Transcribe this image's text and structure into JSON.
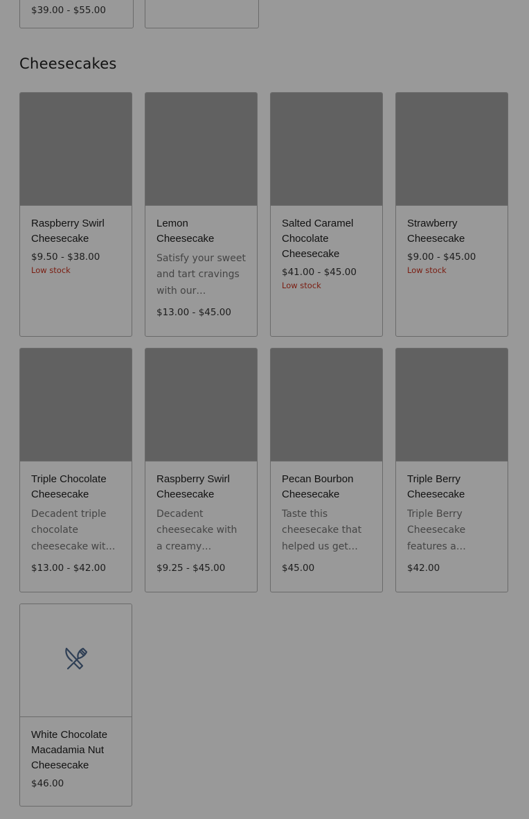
{
  "previous_section": {
    "cards": [
      {
        "price": "$39.00 - $55.00"
      },
      {
        "price": ""
      }
    ]
  },
  "section": {
    "title": "Cheesecakes"
  },
  "products": [
    {
      "name": "Raspberry Swirl Cheesecake",
      "description": "",
      "price": "$9.50 - $38.00",
      "stock": "Low stock"
    },
    {
      "name": "Lemon Cheesecake",
      "description": "Satisfy your sweet and tart cravings with our decaden…",
      "price": "$13.00 - $45.00",
      "stock": ""
    },
    {
      "name": "Salted Caramel Chocolate Cheesecake",
      "description": "",
      "price": "$41.00 - $45.00",
      "stock": "Low stock"
    },
    {
      "name": "Strawberry Cheesecake",
      "description": "",
      "price": "$9.00 - $45.00",
      "stock": "Low stock"
    },
    {
      "name": "Triple Chocolate Cheesecake",
      "description": "Decadent triple chocolate cheesecake with a…",
      "price": "$13.00 - $42.00",
      "stock": ""
    },
    {
      "name": "Raspberry Swirl Cheesecake",
      "description": "Decadent cheesecake with a creamy texture,…",
      "price": "$9.25 - $45.00",
      "stock": ""
    },
    {
      "name": "Pecan Bourbon Cheesecake",
      "description": "Taste this cheesecake that helped us get vot…",
      "price": "$45.00",
      "stock": ""
    },
    {
      "name": "Triple Berry Cheesecake",
      "description": "Triple Berry Cheesecake features a creamy…",
      "price": "$42.00",
      "stock": ""
    },
    {
      "name": "White Chocolate Macadamia Nut Cheesecake",
      "description": "",
      "price": "$46.00",
      "stock": "",
      "image": "utensils-icon"
    }
  ],
  "colors": {
    "overlay_background": "#999999",
    "image_placeholder": "#616161",
    "low_stock": "#7a1c10",
    "icon": "#2f3f55"
  }
}
